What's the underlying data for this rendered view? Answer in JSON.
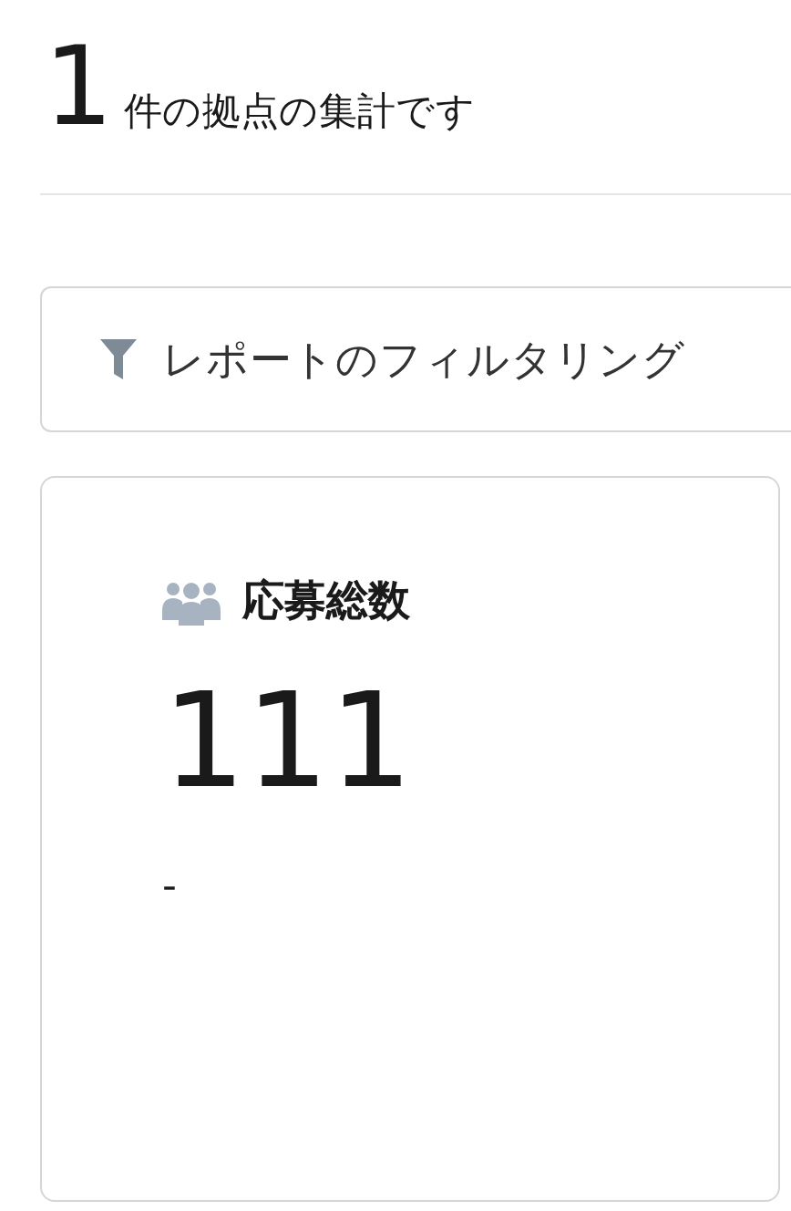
{
  "summary": {
    "count": "1",
    "text": "件の拠点の集計です"
  },
  "filter_button": {
    "label": "レポートのフィルタリング"
  },
  "card": {
    "title": "応募総数",
    "value": "111",
    "note": "-"
  }
}
